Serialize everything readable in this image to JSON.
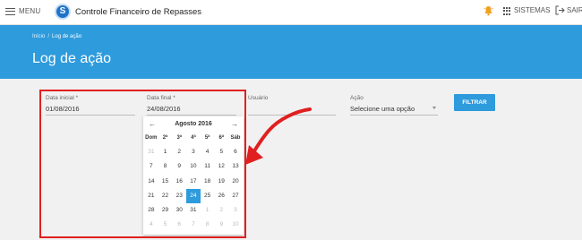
{
  "topbar": {
    "menu_label": "MENU",
    "logo_letter": "S",
    "app_title": "Controle Financeiro de Repasses",
    "sistemas_label": "SISTEMAS",
    "sair_label": "SAIR",
    "icons": [
      "menu-icon",
      "logo-icon",
      "bell-icon",
      "grid-icon",
      "exit-icon"
    ],
    "bell_color": "#f0a020"
  },
  "hero": {
    "breadcrumb": [
      "Início",
      "Log de ação"
    ],
    "title": "Log de ação",
    "bg_color": "#2e9bdd"
  },
  "filters": {
    "data_inicial": {
      "label": "Data inicial *",
      "value": "01/08/2016"
    },
    "data_final": {
      "label": "Data final *",
      "value": "24/08/2016"
    },
    "usuario": {
      "label": "Usuário",
      "value": ""
    },
    "acao": {
      "label": "Ação",
      "value": "Selecione uma opção"
    },
    "filtrar_label": "FILTRAR"
  },
  "calendar": {
    "prev": "←",
    "next": "→",
    "month": "Agosto 2016",
    "weekdays": [
      "Dom",
      "2ª",
      "3ª",
      "4ª",
      "5ª",
      "6ª",
      "Sáb"
    ],
    "days": [
      [
        "31",
        "1",
        "2",
        "3",
        "4",
        "5",
        "6"
      ],
      [
        "7",
        "8",
        "9",
        "10",
        "11",
        "12",
        "13"
      ],
      [
        "14",
        "15",
        "16",
        "17",
        "18",
        "19",
        "20"
      ],
      [
        "21",
        "22",
        "23",
        "24",
        "25",
        "26",
        "27"
      ],
      [
        "28",
        "29",
        "30",
        "31",
        "1",
        "2",
        "3"
      ],
      [
        "4",
        "5",
        "6",
        "7",
        "8",
        "9",
        "10"
      ]
    ],
    "selected": "24",
    "accent": "#2e9bdd"
  },
  "annotation": {
    "color": "#e02020"
  }
}
